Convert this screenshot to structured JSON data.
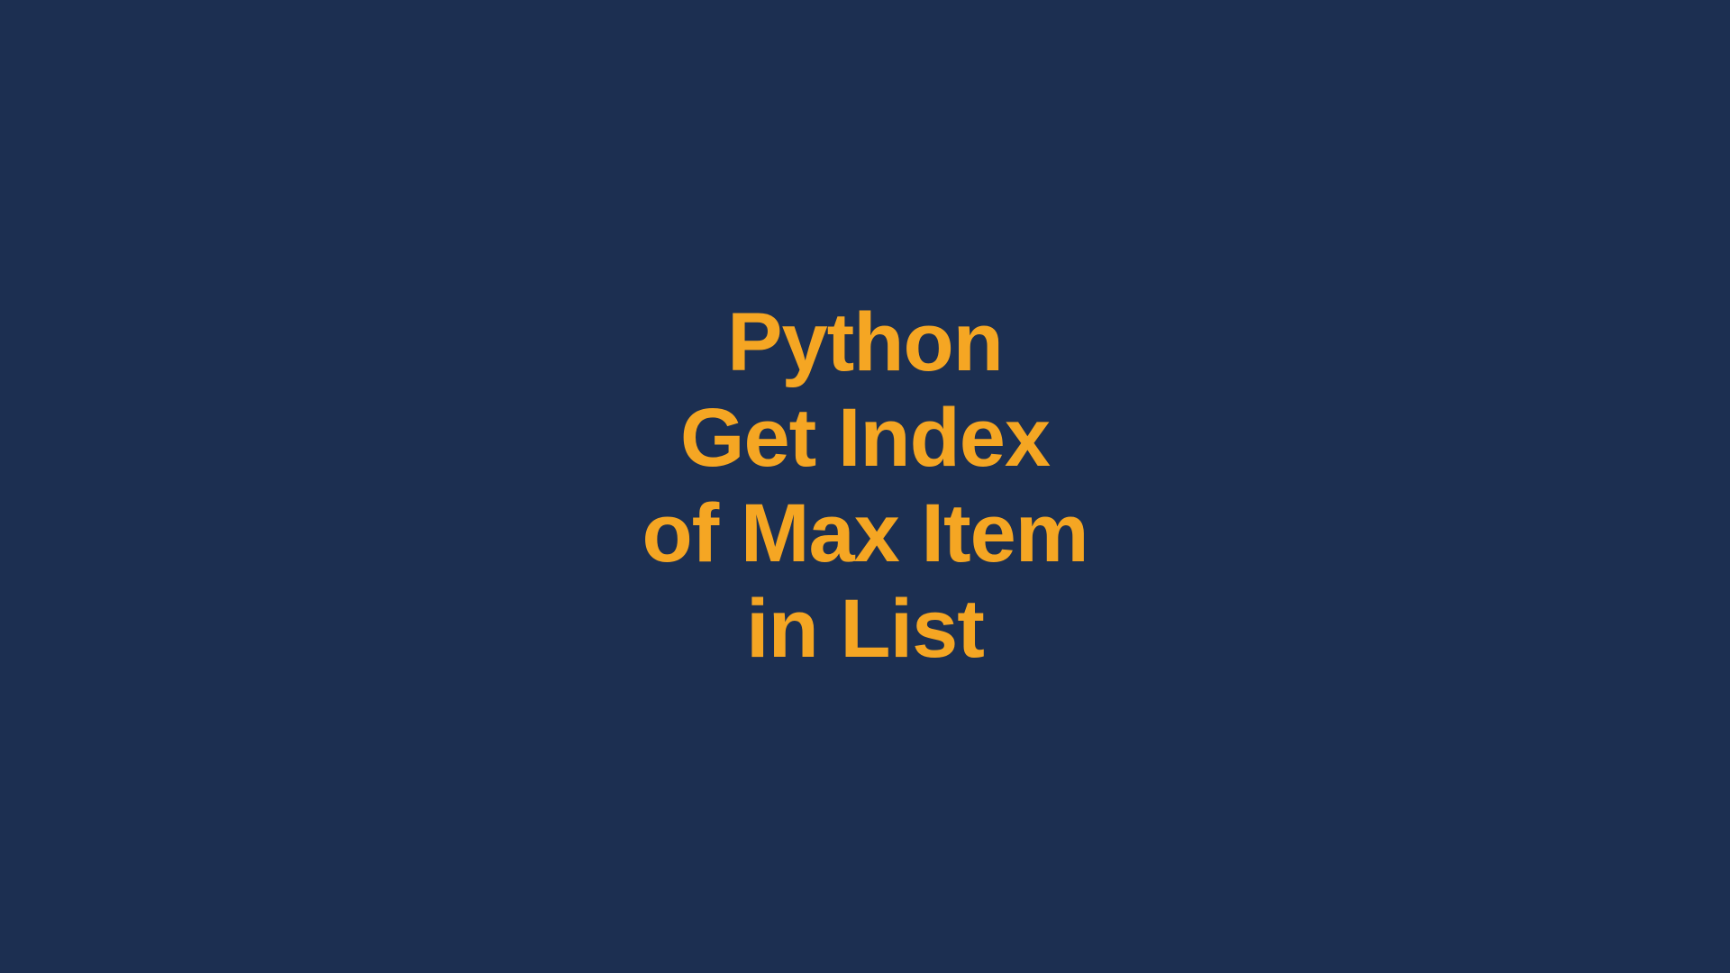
{
  "title": {
    "line1": "Python",
    "line2": "Get Index",
    "line3": "of Max Item",
    "line4": "in List"
  }
}
